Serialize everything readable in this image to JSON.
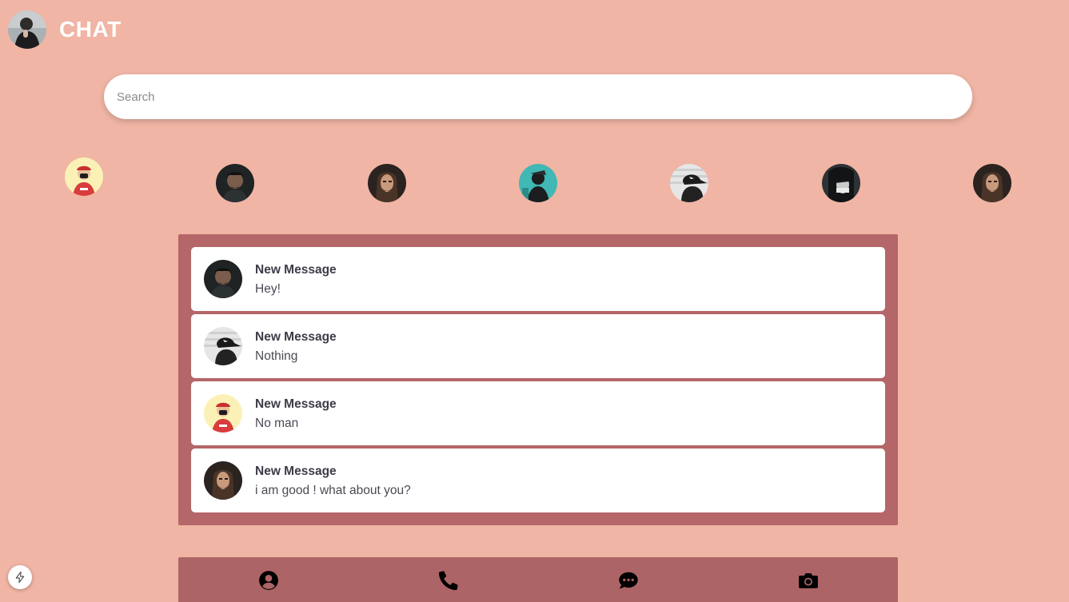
{
  "header": {
    "title": "CHAT",
    "avatar_icon": "user-avatar-icon"
  },
  "search": {
    "placeholder": "Search",
    "value": ""
  },
  "stories": [
    {
      "icon": "story-avatar-red-icon"
    },
    {
      "icon": "story-avatar-dark-icon"
    },
    {
      "icon": "story-avatar-longhair-icon"
    },
    {
      "icon": "story-avatar-teal-icon"
    },
    {
      "icon": "story-avatar-cap-icon"
    },
    {
      "icon": "story-avatar-gray-icon"
    },
    {
      "icon": "story-avatar-longhair-icon"
    }
  ],
  "messages": [
    {
      "title": "New Message",
      "text": "Hey!"
    },
    {
      "title": "New Message",
      "text": "Nothing"
    },
    {
      "title": "New Message",
      "text": "No man"
    },
    {
      "title": "New Message",
      "text": "i am good ! what about you?"
    }
  ],
  "nav": [
    {
      "icon": "user-circle-icon"
    },
    {
      "icon": "phone-icon"
    },
    {
      "icon": "chat-bubble-icon"
    },
    {
      "icon": "camera-icon"
    }
  ],
  "colors": {
    "background": "#f0b5a5",
    "panel": "#b46668",
    "nav": "#ad6466",
    "card": "#ffffff"
  }
}
